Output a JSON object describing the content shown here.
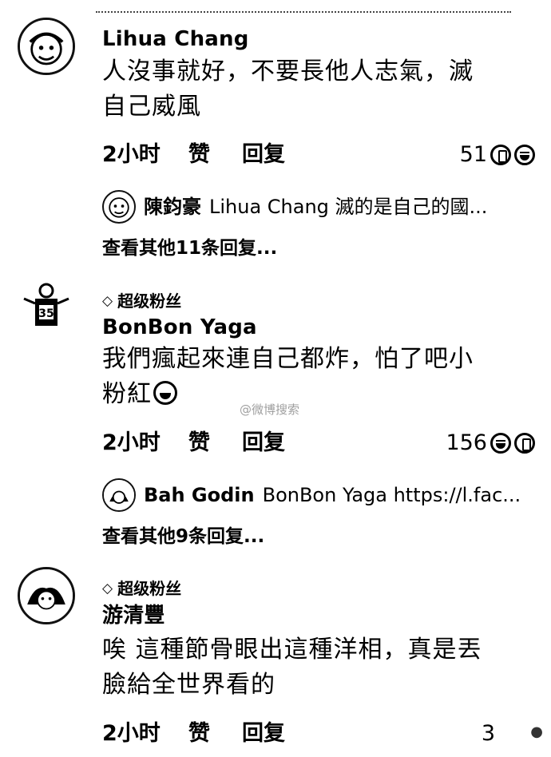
{
  "comments": [
    {
      "badge": "",
      "name": "Lihua Chang",
      "text_line1": "人沒事就好，不要長他人志氣，滅",
      "text_line2": "自己威風",
      "time": "2小时",
      "like": "赞",
      "reply": "回复",
      "reaction_count": "51",
      "reply_preview": {
        "name": "陳鈞豪",
        "text": "Lihua Chang 滅的是自己的國..."
      },
      "more_replies": "查看其他11条回复..."
    },
    {
      "badge": "超级粉丝",
      "name": "BonBon Yaga",
      "text_line1": "我們瘋起來連自己都炸，怕了吧小",
      "text_line2": "粉紅",
      "time": "2小时",
      "like": "赞",
      "reply": "回复",
      "reaction_count": "156",
      "reply_preview": {
        "name": "Bah Godin",
        "text": "BonBon Yaga https://l.fac..."
      },
      "more_replies": "查看其他9条回复..."
    },
    {
      "badge": "超级粉丝",
      "name": "游清豐",
      "text_line1": "唉 這種節骨眼出這種洋相，真是丟",
      "text_line2": "臉給全世界看的",
      "time": "2小时",
      "like": "赞",
      "reply": "回复",
      "reaction_count": "3"
    }
  ],
  "icons": {
    "badge": "diamond-icon",
    "reactions": [
      "thumb-icon",
      "laugh-icon"
    ]
  },
  "watermark": "@微博搜索"
}
